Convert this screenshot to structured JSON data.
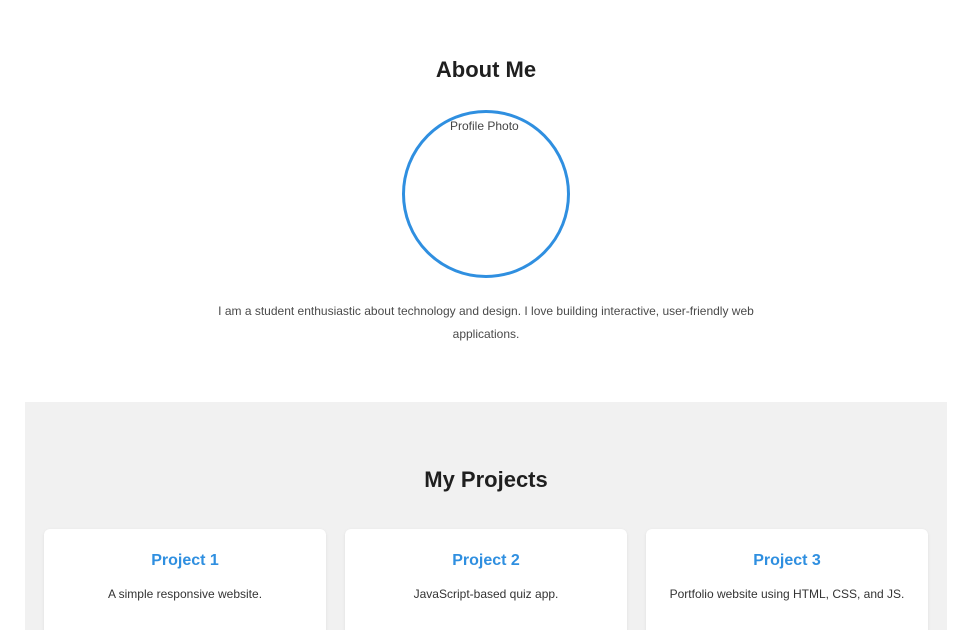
{
  "about": {
    "title": "About Me",
    "photo_alt": "Profile Photo",
    "bio": "I am a student enthusiastic about technology and design. I love building interactive, user-friendly web applications."
  },
  "projects": {
    "title": "My Projects",
    "items": [
      {
        "title": "Project 1",
        "description": "A simple responsive website."
      },
      {
        "title": "Project 2",
        "description": "JavaScript-based quiz app."
      },
      {
        "title": "Project 3",
        "description": "Portfolio website using HTML, CSS, and JS."
      }
    ]
  },
  "colors": {
    "accent": "#2f8fe0",
    "section_bg": "#f1f1f1",
    "card_bg": "#ffffff",
    "heading": "#1f1f1f",
    "body_text": "#4a4a4a"
  }
}
